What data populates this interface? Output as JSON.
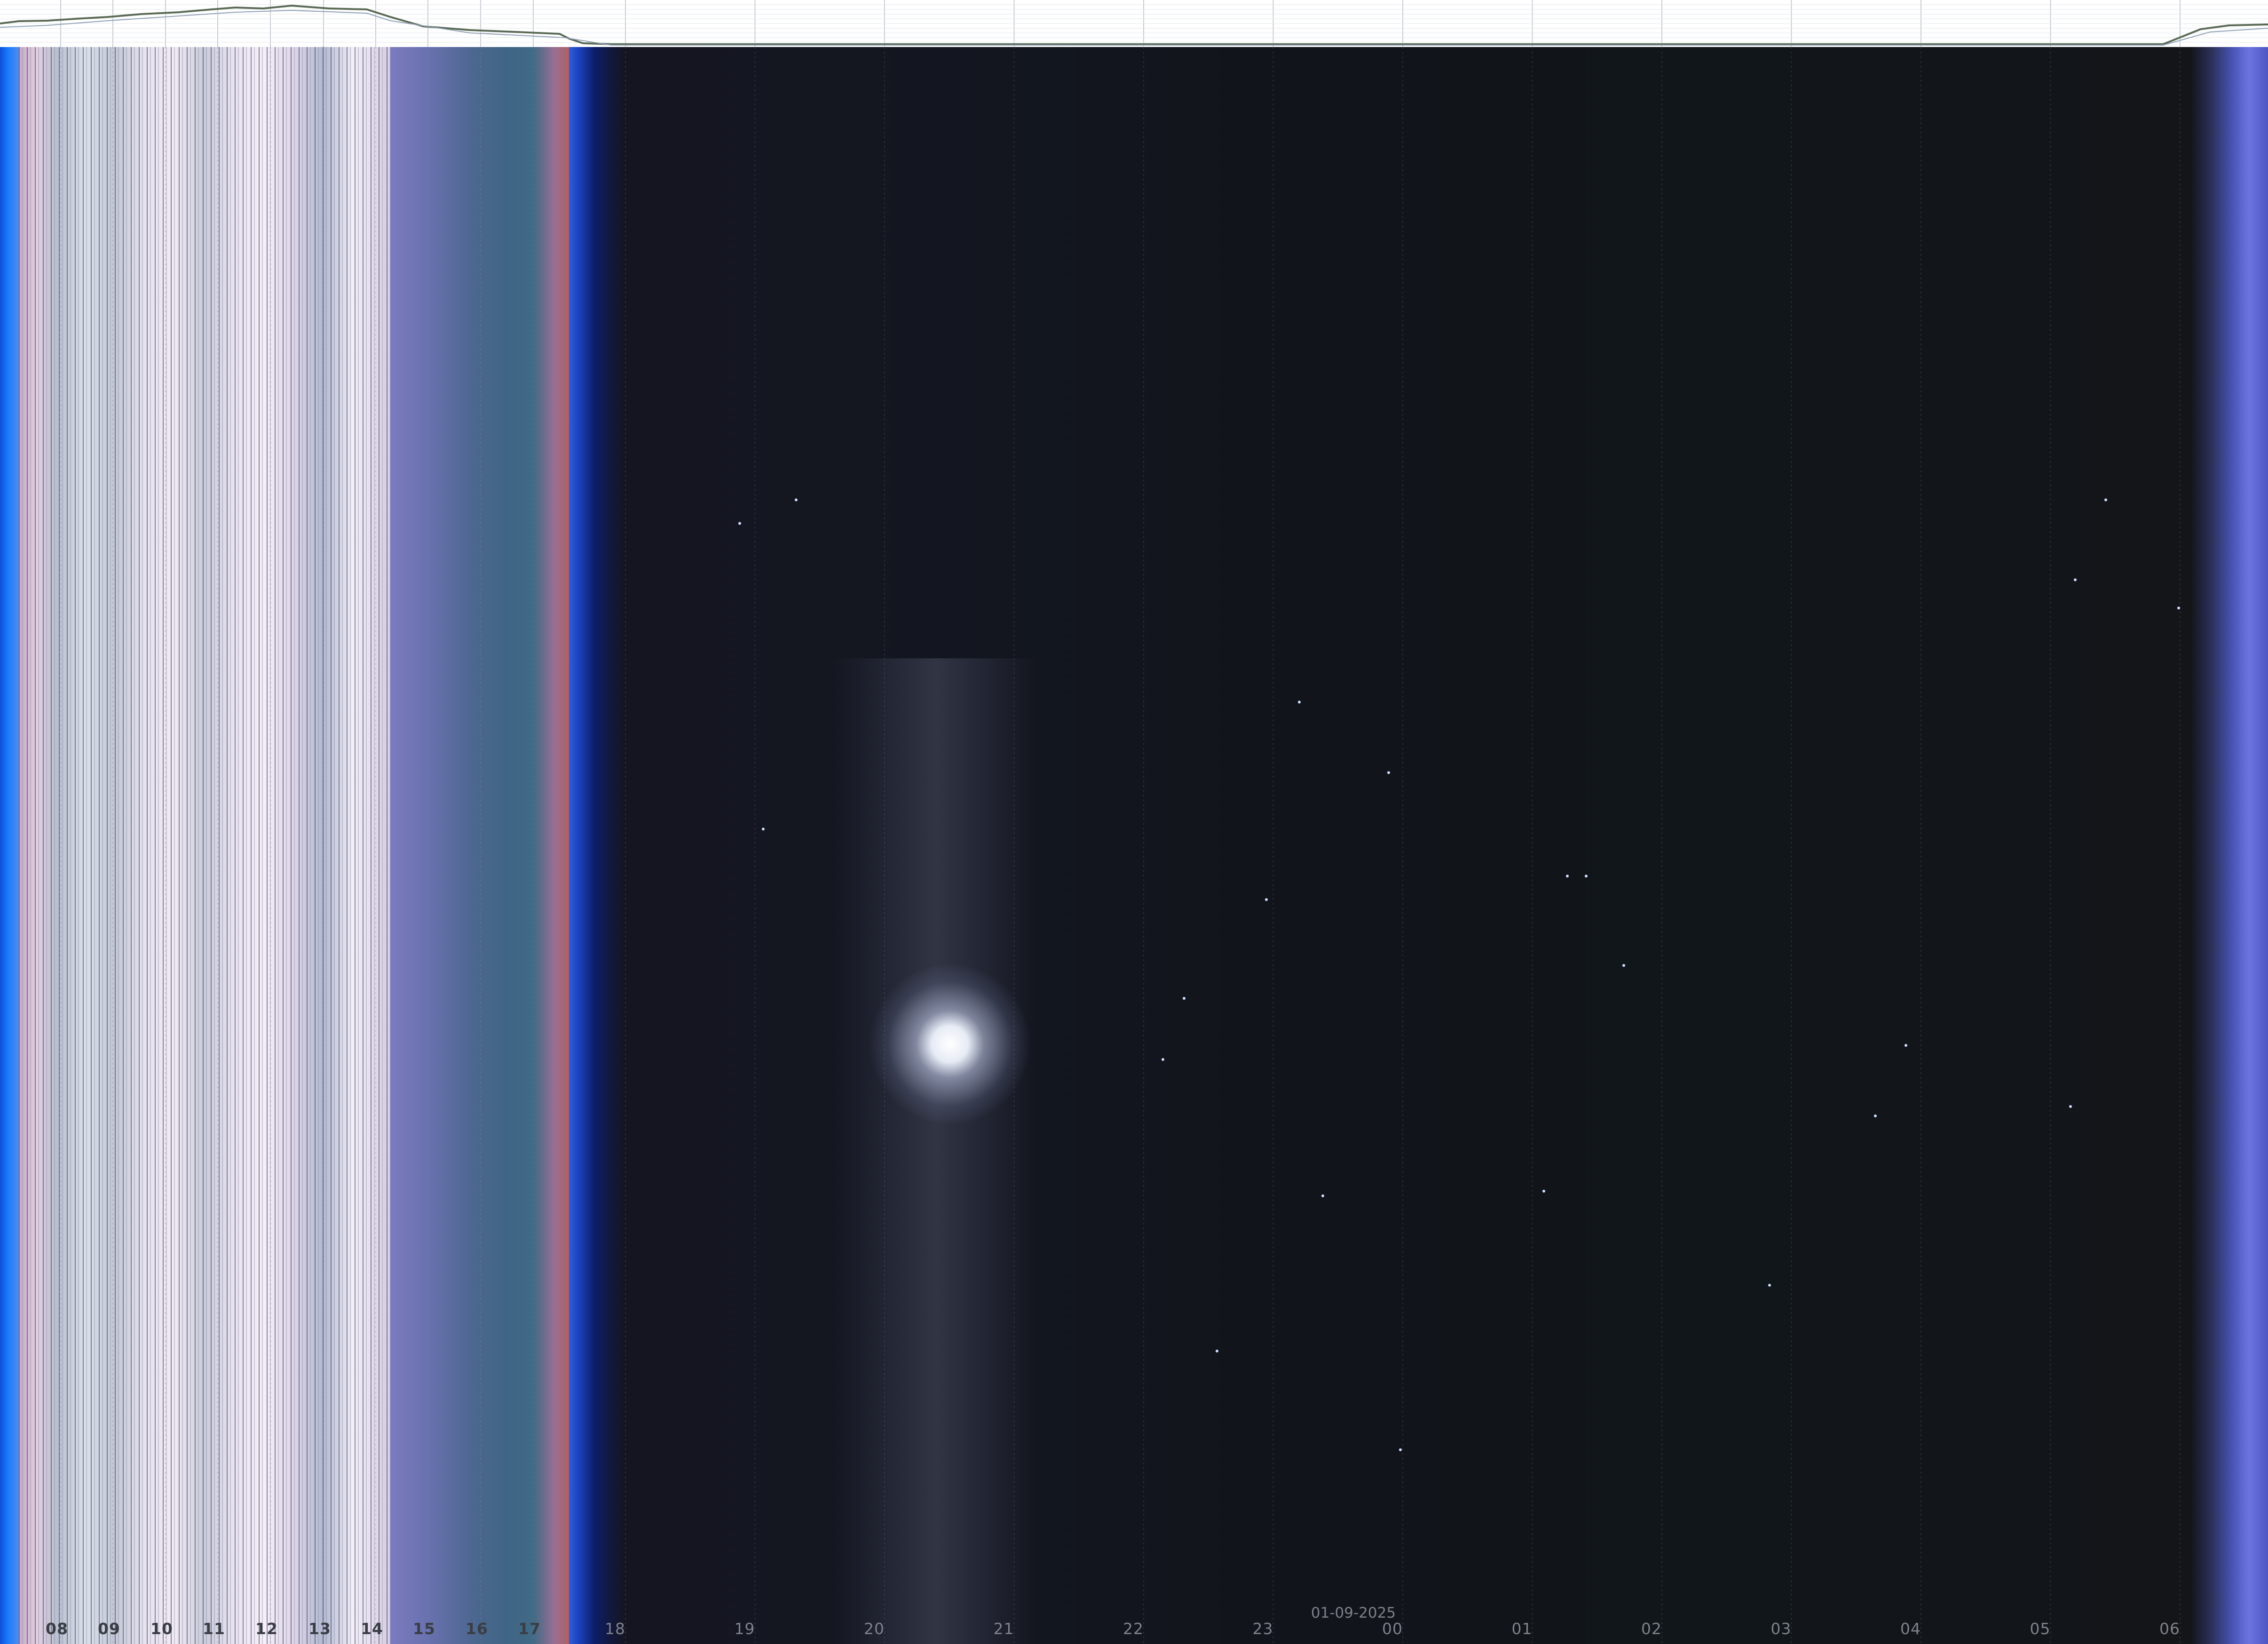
{
  "timeline": {
    "date_label": "01-09-2025",
    "hour_labels": [
      "08",
      "09",
      "10",
      "11",
      "12",
      "13",
      "14",
      "15",
      "16",
      "17",
      "18",
      "19",
      "20",
      "21",
      "22",
      "23",
      "00",
      "01",
      "02",
      "03",
      "04",
      "05",
      "06"
    ]
  },
  "colors": {
    "night_sky": "#11141a",
    "daylight": "#e8e3ef",
    "twilight_blue": "#1c45c4",
    "dawn_blue": "#6c74e0",
    "moon": "#ffffff"
  }
}
